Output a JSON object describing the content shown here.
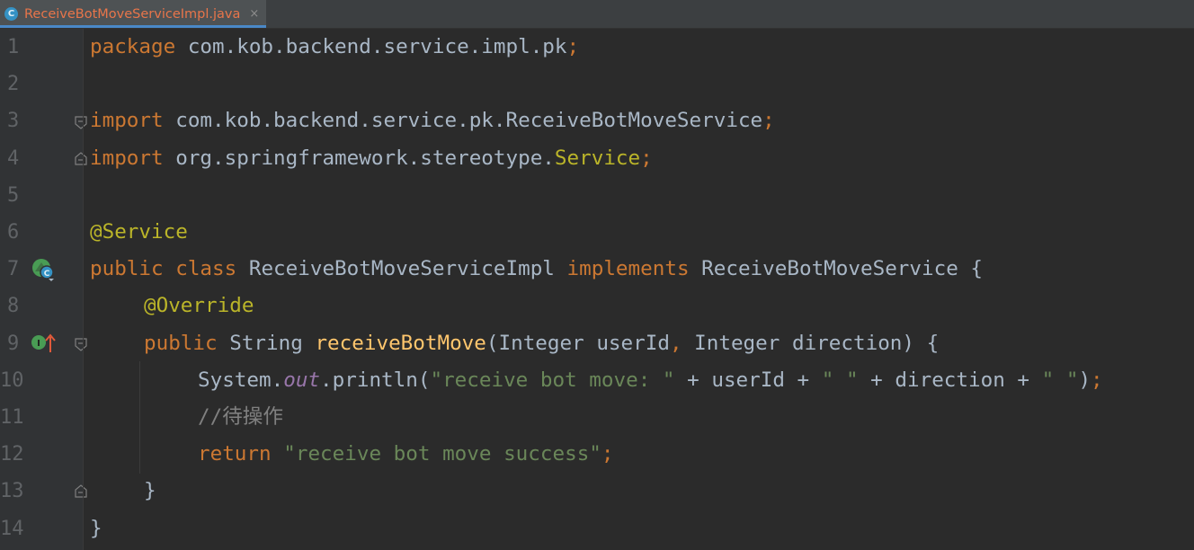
{
  "tab": {
    "icon_letter": "C",
    "title": "ReceiveBotMoveServiceImpl.java",
    "close": "×"
  },
  "line_numbers": [
    "1",
    "2",
    "3",
    "4",
    "5",
    "6",
    "7",
    "8",
    "9",
    "10",
    "11",
    "12",
    "13",
    "14"
  ],
  "code": {
    "l1": {
      "kw": "package",
      "rest": " com.kob.backend.service.impl.pk",
      "semi": ";"
    },
    "l3": {
      "kw": "import",
      "rest": " com.kob.backend.service.pk.ReceiveBotMoveService",
      "semi": ";"
    },
    "l4": {
      "kw": "import",
      "rest": " org.springframework.stereotype.",
      "cls": "Service",
      "semi": ";"
    },
    "l6": {
      "ann": "@Service"
    },
    "l7": {
      "kw1": "public class",
      "name": " ReceiveBotMoveServiceImpl ",
      "kw2": "implements",
      "rest": " ReceiveBotMoveService {"
    },
    "l8": {
      "ann": "@Override"
    },
    "l9": {
      "kw": "public",
      "type": " String ",
      "fn": "receiveBotMove",
      "p1": "(Integer userId",
      "comma": ",",
      "p2": " Integer direction) {"
    },
    "l10": {
      "sys": "System.",
      "out": "out",
      "call": ".println(",
      "s1": "\"receive bot move: \"",
      "op1": " + userId + ",
      "s2": "\" \"",
      "op2": " + direction + ",
      "s3": "\" \"",
      "close": ")",
      "semi": ";"
    },
    "l11": {
      "comment": "//待操作"
    },
    "l12": {
      "kw": "return",
      "sp": " ",
      "str": "\"receive bot move success\"",
      "semi": ";"
    },
    "l13": {
      "brace": "}"
    },
    "l14": {
      "brace": "}"
    }
  },
  "colors": {
    "background": "#2b2b2b",
    "gutter": "#313335",
    "keyword": "#cc7832",
    "annotation": "#bbb529",
    "string": "#6a8759",
    "method": "#ffc66d",
    "field": "#9876aa",
    "comment": "#808080",
    "text": "#a9b7c6",
    "tab_title": "#e8754a"
  },
  "gutter_icons": {
    "line7": "implemented-class-icon",
    "line9": "implements-method-icon"
  }
}
